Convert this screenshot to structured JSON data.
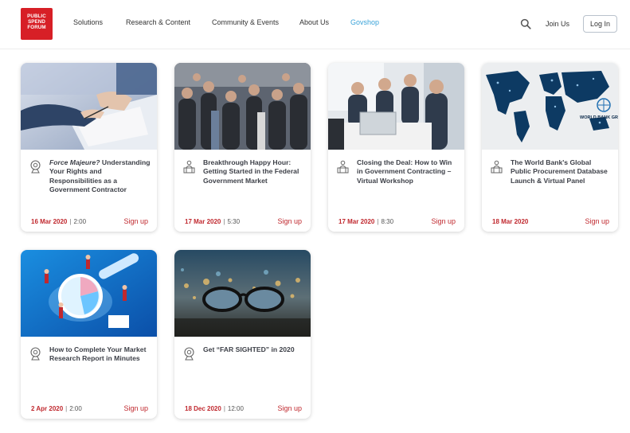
{
  "logo": {
    "lines": [
      "PUBLIC",
      "SPEND",
      "FORUM"
    ]
  },
  "nav": [
    {
      "label": "Solutions",
      "active": false
    },
    {
      "label": "Research & Content",
      "active": false
    },
    {
      "label": "Community & Events",
      "active": false
    },
    {
      "label": "About Us",
      "active": false
    },
    {
      "label": "Govshop",
      "active": true
    }
  ],
  "header": {
    "join_label": "Join Us",
    "login_label": "Log In"
  },
  "colors": {
    "brand_red": "#d71f26",
    "accent_blue": "#3aa3d9",
    "date_red": "#c0282e"
  },
  "events": [
    {
      "title_italic": "Force Majeure?",
      "title": "Understanding Your Rights and Responsibilities as a Government Contractor",
      "date": "16 Mar 2020",
      "time": "2:00",
      "signup": "Sign up",
      "image": "signing-contract-photo"
    },
    {
      "title_italic": "",
      "title": "Breakthrough Happy Hour: Getting Started in the Federal Government Market",
      "date": "17 Mar 2020",
      "time": "5:30",
      "signup": "Sign up",
      "image": "crowd-networking-photo"
    },
    {
      "title_italic": "",
      "title": "Closing the Deal: How to Win in Government Contracting – Virtual Workshop",
      "date": "17 Mar 2020",
      "time": "8:30",
      "signup": "Sign up",
      "image": "team-laptop-photo"
    },
    {
      "title_italic": "",
      "title": "The World Bank's Global Public Procurement Database Launch & Virtual Panel",
      "date": "18 Mar 2020",
      "time": "",
      "signup": "Sign up",
      "image": "world-map-photo",
      "image_text": "WORLD BANK GR"
    },
    {
      "title_italic": "",
      "title": "How to Complete Your Market Research Report in Minutes",
      "date": "2 Apr 2020",
      "time": "2:00",
      "signup": "Sign up",
      "image": "market-research-illustration"
    },
    {
      "title_italic": "",
      "title": "Get “FAR SIGHTED” in 2020",
      "date": "18 Dec 2020",
      "time": "12:00",
      "signup": "Sign up",
      "image": "glasses-city-photo"
    }
  ]
}
